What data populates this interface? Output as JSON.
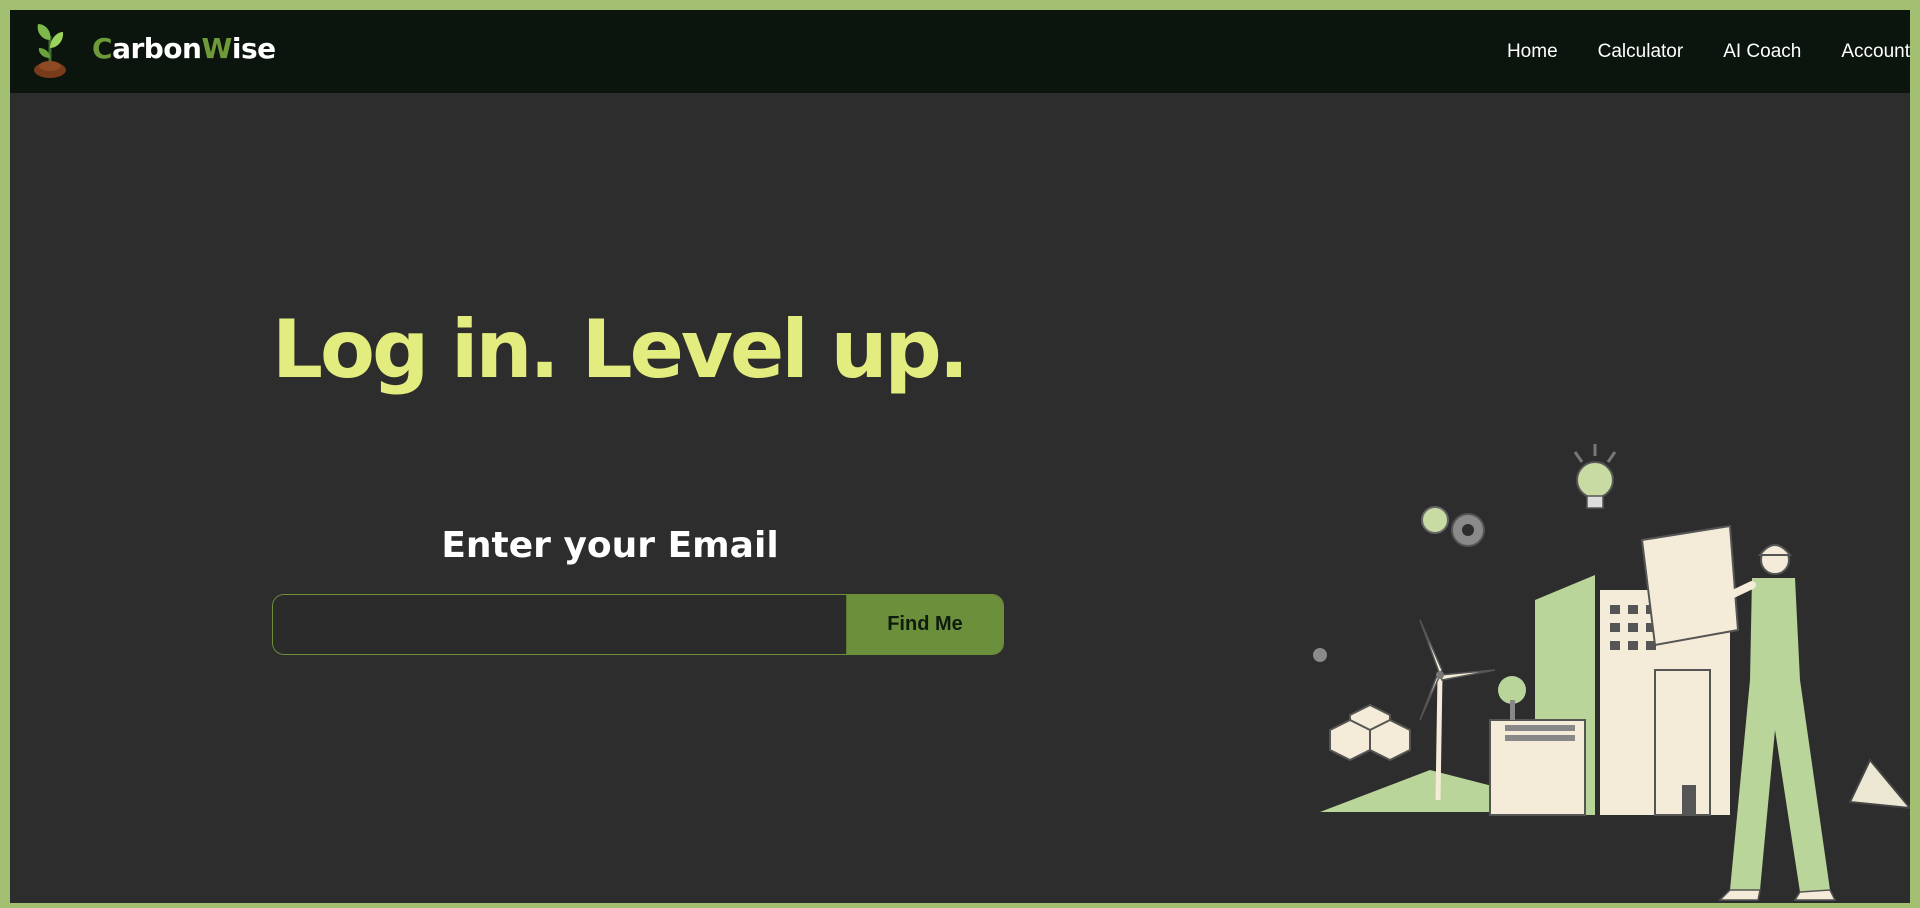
{
  "brand": {
    "first_letter": "C",
    "part_one": "arbon",
    "second_letter": "W",
    "part_two": "ise",
    "accent_color": "#6e9a3a"
  },
  "nav": {
    "items": [
      {
        "label": "Home"
      },
      {
        "label": "Calculator"
      },
      {
        "label": "AI Coach"
      },
      {
        "label": "Account"
      }
    ]
  },
  "hero": {
    "headline": "Log in. Level up.",
    "headline_color": "#e3ec7e",
    "email_label": "Enter your Email",
    "email_value": "",
    "button_label": "Find Me",
    "button_color": "#6b8f3a"
  },
  "icons": {
    "logo": "sprout-icon",
    "illustration": "green-city-worker-illustration"
  },
  "colors": {
    "page_border": "#a3bf72",
    "background": "#2d2d2d",
    "navbar": "#0b140d"
  }
}
